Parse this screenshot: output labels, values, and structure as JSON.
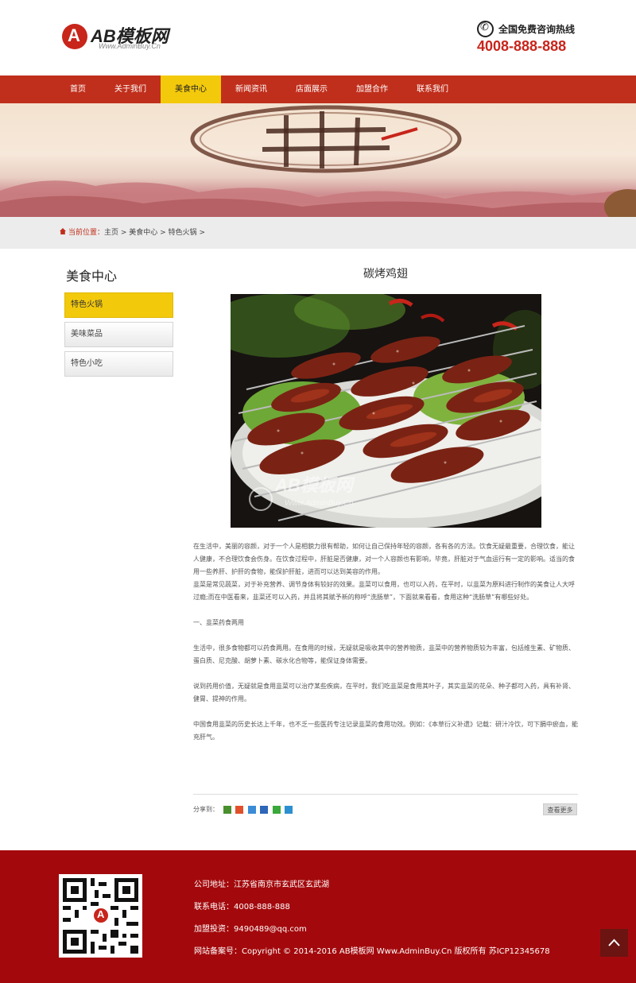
{
  "header": {
    "logo_mark": "A",
    "logo_text": "AB模板网",
    "logo_sub": "Www.AdminBuy.Cn",
    "hotline_label": "全国免费咨询热线",
    "hotline_number": "4008-888-888"
  },
  "nav": {
    "items": [
      "首页",
      "关于我们",
      "美食中心",
      "新闻资讯",
      "店面展示",
      "加盟合作",
      "联系我们"
    ],
    "active_index": 2
  },
  "breadcrumb": {
    "label": "当前位置：",
    "items": [
      "主页",
      "美食中心",
      "特色火锅"
    ],
    "separator": " > "
  },
  "sidebar": {
    "title": "美食中心",
    "items": [
      "特色火锅",
      "美味菜品",
      "特色小吃"
    ],
    "active_index": 0
  },
  "article": {
    "title": "碳烤鸡翅",
    "watermark_text": "AB模板网",
    "watermark_sub": "Www.AdminBuy.Cn",
    "paragraphs": [
      "在生活中，美丽的容颜，对于一个人是相貌力很有帮助，如何让自己保持年轻的容颜，各有各的方法。饮食无疑最重要，合理饮食，能让人健康，不合理饮食会伤身。在饮食过程中，肝脏是否健康，对一个人容颜也有影响，毕竟，肝脏对于气血运行有一定的影响。适当的食用一些养肝、护肝的食物，能保护肝脏，进而可以达到美容的作用。",
      "韭菜是常见蔬菜，对于补充营养、调节身体有较好的效果。韭菜可以食用，也可以入药，在平时，以韭菜为原料进行制作的美食让人大呼过瘾;而在中医看来，韭菜还可以入药，并且将其赋予新的称呼“洗肠草”，下面就来看看，食用这种“洗肠草”有哪些好处。",
      "",
      "一、韭菜药食两用",
      "",
      "生活中，很多食物都可以药食两用。在食用的时候，无疑就是吸收其中的营养物质，韭菜中的营养物质较为丰富，包括维生素、矿物质、蛋白质、尼克酸、胡萝卜素、碳水化合物等，能保证身体需要。",
      "",
      "说到药用价值，无疑就是食用韭菜可以治疗某些疾病，在平时，我们吃韭菜是食用其叶子，其实韭菜的花朵、种子都可入药，具有补肾、健胃、提神的作用。",
      "",
      "中国食用韭菜的历史长达上千年，也不乏一些医药专注记录韭菜的食用功效。例如：《本草衍义补遗》记载：研汁冷饮，可下膈中瘀血，能充肝气。"
    ],
    "share_label": "分享到：",
    "more_label": "查看更多"
  },
  "footer": {
    "address": "公司地址：江苏省南京市玄武区玄武湖",
    "phone": "联系电话：4008-888-888",
    "join": "加盟投资：9490489@qq.com",
    "record": "网站备案号：Copyright © 2014-2016 AB模板网 Www.AdminBuy.Cn 版权所有   苏ICP12345678"
  },
  "colors": {
    "brand_red": "#c02f1c",
    "nav_active": "#f3c90c",
    "footer_bg": "#a3090c"
  }
}
